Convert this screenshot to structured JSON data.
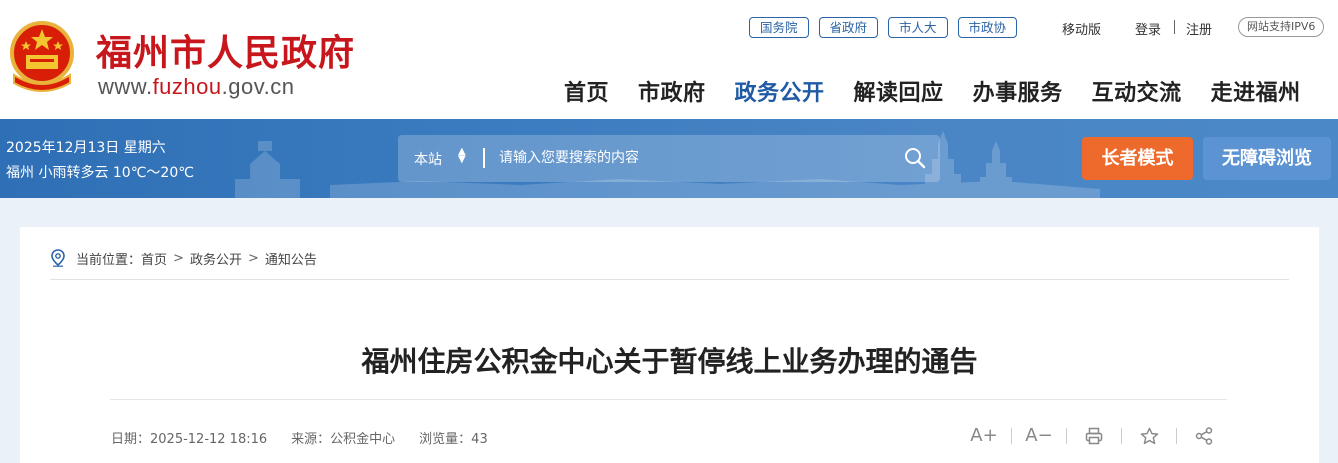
{
  "header": {
    "site_name": "福州市人民政府",
    "domain_prefix": "www.",
    "domain_highlight": "fuzhou",
    "domain_suffix": ".gov.cn",
    "top_links": [
      "国务院",
      "省政府",
      "市人大",
      "市政协"
    ],
    "mobile_label": "移动版",
    "login_label": "登录",
    "register_label": "注册",
    "ipv6_label": "网站支持IPV6",
    "nav": [
      "首页",
      "市政府",
      "政务公开",
      "解读回应",
      "办事服务",
      "互动交流",
      "走进福州"
    ],
    "active_nav": "政务公开"
  },
  "banner": {
    "date": "2025年12月13日 星期六",
    "weather": "福州 小雨转多云 10℃～20℃",
    "search_scope": "本站",
    "search_placeholder": "请输入您要搜索的内容",
    "elder_mode_label": "长者模式",
    "accessible_label": "无障碍浏览"
  },
  "breadcrumb": {
    "prefix": "当前位置：",
    "items": [
      "首页",
      "政务公开",
      "通知公告"
    ],
    "separator": ">"
  },
  "article": {
    "title": "福州住房公积金中心关于暂停线上业务办理的通告",
    "date_label": "日期：2025-12-12 18:16",
    "source_label": "来源：公积金中心",
    "views_label": "浏览量：43"
  },
  "tools": {
    "font_increase": "A+",
    "font_decrease": "A−"
  },
  "colors": {
    "brand_red": "#c8161d",
    "nav_active": "#1f5ba5",
    "banner_blue": "#3c7cc0",
    "elder_button": "#ee6a2c",
    "accessible_button": "#5b93d3"
  }
}
